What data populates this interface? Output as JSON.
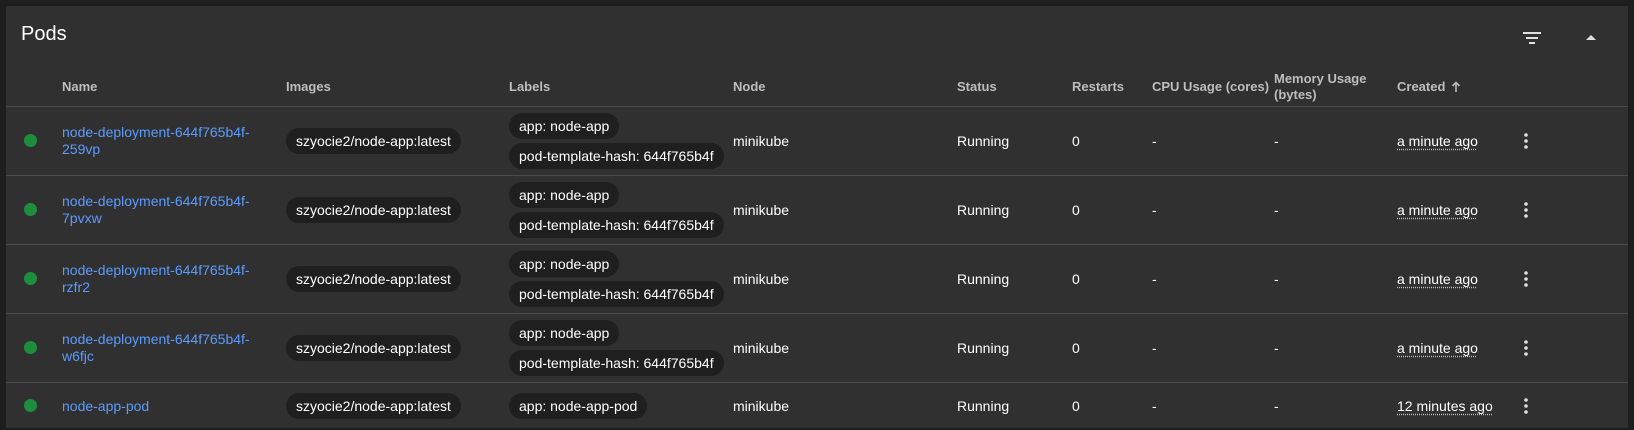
{
  "card": {
    "title": "Pods",
    "filter_icon": "filter-list-icon",
    "collapse_icon": "arrow-drop-up-icon"
  },
  "columns": {
    "name": "Name",
    "images": "Images",
    "labels": "Labels",
    "node": "Node",
    "status": "Status",
    "restarts": "Restarts",
    "cpu": "CPU Usage (cores)",
    "memory_line1": "Memory Usage",
    "memory_line2": "(bytes)",
    "created": "Created",
    "sort_icon": "arrow-upward-icon"
  },
  "colors": {
    "status_ok": "#1e8e3e",
    "link": "#5b9bff",
    "card_bg": "#303030"
  },
  "rows": [
    {
      "name": "node-deployment-644f765b4f-259vp",
      "image": "szyocie2/node-app:latest",
      "labels": [
        "app: node-app",
        "pod-template-hash: 644f765b4f"
      ],
      "node": "minikube",
      "status": "Running",
      "restarts": "0",
      "cpu": "-",
      "memory": "-",
      "created": "a minute ago"
    },
    {
      "name": "node-deployment-644f765b4f-7pvxw",
      "image": "szyocie2/node-app:latest",
      "labels": [
        "app: node-app",
        "pod-template-hash: 644f765b4f"
      ],
      "node": "minikube",
      "status": "Running",
      "restarts": "0",
      "cpu": "-",
      "memory": "-",
      "created": "a minute ago"
    },
    {
      "name": "node-deployment-644f765b4f-rzfr2",
      "image": "szyocie2/node-app:latest",
      "labels": [
        "app: node-app",
        "pod-template-hash: 644f765b4f"
      ],
      "node": "minikube",
      "status": "Running",
      "restarts": "0",
      "cpu": "-",
      "memory": "-",
      "created": "a minute ago"
    },
    {
      "name": "node-deployment-644f765b4f-w6fjc",
      "image": "szyocie2/node-app:latest",
      "labels": [
        "app: node-app",
        "pod-template-hash: 644f765b4f"
      ],
      "node": "minikube",
      "status": "Running",
      "restarts": "0",
      "cpu": "-",
      "memory": "-",
      "created": "a minute ago"
    },
    {
      "name": "node-app-pod",
      "image": "szyocie2/node-app:latest",
      "labels": [
        "app: node-app-pod"
      ],
      "node": "minikube",
      "status": "Running",
      "restarts": "0",
      "cpu": "-",
      "memory": "-",
      "created": "12 minutes ago"
    }
  ]
}
